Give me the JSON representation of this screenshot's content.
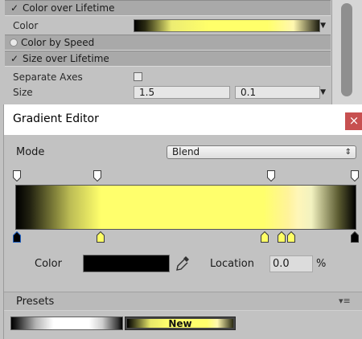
{
  "inspector": {
    "color_over_lifetime": {
      "check": "✓",
      "label": "Color over Lifetime"
    },
    "color_row": {
      "label": "Color"
    },
    "color_by_speed": {
      "label": "Color by Speed"
    },
    "size_over_lifetime": {
      "check": "✓",
      "label": "Size over Lifetime"
    },
    "separate_axes": {
      "label": "Separate Axes"
    },
    "size": {
      "label": "Size",
      "value_a": "1.5",
      "value_b": "0.1"
    }
  },
  "editor": {
    "title": "Gradient Editor",
    "close_glyph": "×",
    "mode": {
      "label": "Mode",
      "value": "Blend",
      "arrows": "⇕"
    },
    "color_label": "Color",
    "location_label": "Location",
    "location_value": "0.0",
    "percent_symbol": "%",
    "presets_label": "Presets",
    "presets_menu_glyph": "▾≡",
    "preset_new_label": "New"
  },
  "markers": {
    "alpha_keys": [
      {
        "location_pct": 0,
        "selected": false,
        "color": "#ffffff"
      },
      {
        "location_pct": 24,
        "selected": false,
        "color": "#ffffff"
      },
      {
        "location_pct": 75,
        "selected": false,
        "color": "#ffffff"
      },
      {
        "location_pct": 100,
        "selected": false,
        "color": "#ffffff"
      }
    ],
    "color_keys": [
      {
        "location_pct": 0,
        "selected": true,
        "color": "#000000"
      },
      {
        "location_pct": 25,
        "selected": false,
        "color": "#ffff66"
      },
      {
        "location_pct": 73,
        "selected": false,
        "color": "#ffff66"
      },
      {
        "location_pct": 78,
        "selected": false,
        "color": "#ffff66"
      },
      {
        "location_pct": 81,
        "selected": false,
        "color": "#ffff66"
      },
      {
        "location_pct": 100,
        "selected": false,
        "color": "#000000"
      }
    ]
  },
  "colors": {
    "selected_color": "#000000",
    "accent_yellow": "#ffff6c",
    "close_button": "#c75050"
  }
}
